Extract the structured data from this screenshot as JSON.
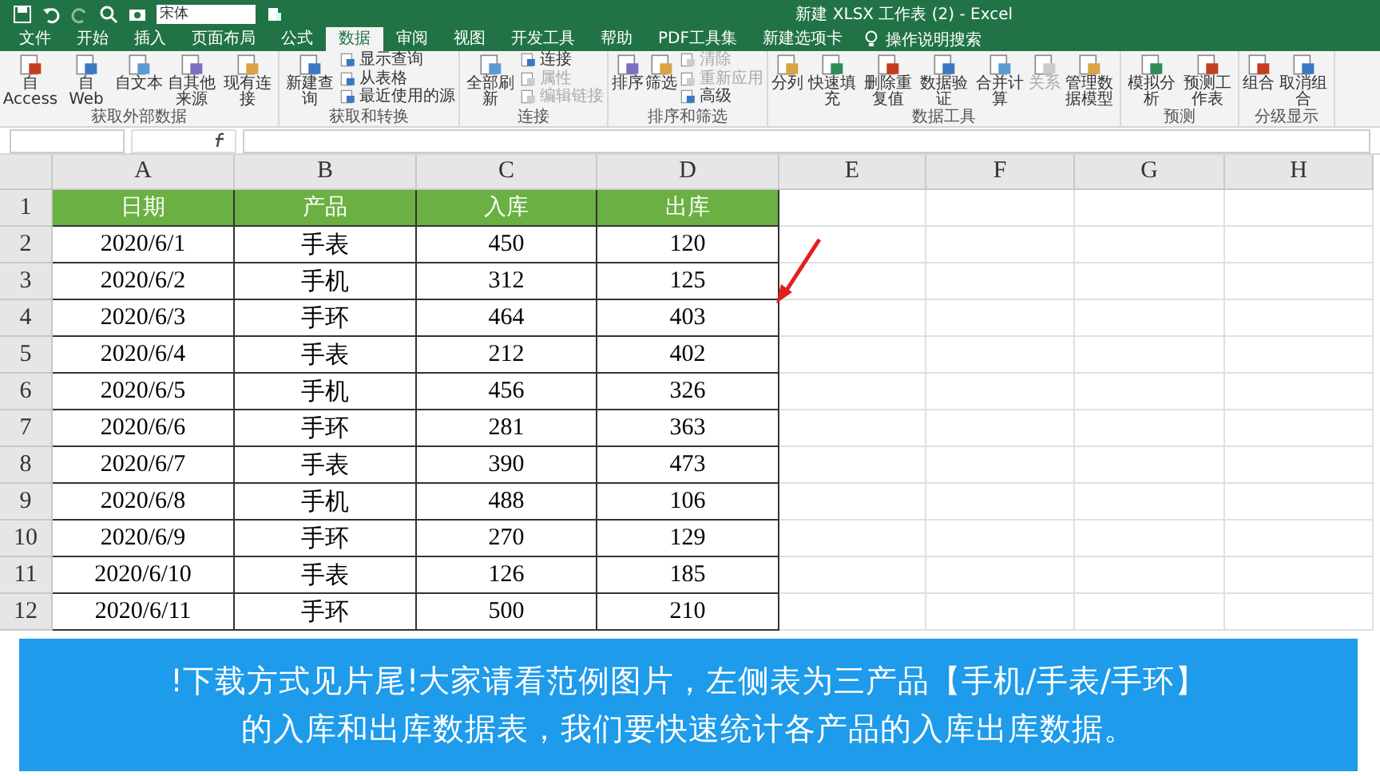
{
  "title_bar": {
    "font_box": "宋体",
    "title": "新建 XLSX 工作表 (2) - Excel"
  },
  "tabs": [
    {
      "label": "文件",
      "selected": false
    },
    {
      "label": "开始",
      "selected": false
    },
    {
      "label": "插入",
      "selected": false
    },
    {
      "label": "页面布局",
      "selected": false
    },
    {
      "label": "公式",
      "selected": false
    },
    {
      "label": "数据",
      "selected": true
    },
    {
      "label": "审阅",
      "selected": false
    },
    {
      "label": "视图",
      "selected": false
    },
    {
      "label": "开发工具",
      "selected": false
    },
    {
      "label": "帮助",
      "selected": false
    },
    {
      "label": "PDF工具集",
      "selected": false
    },
    {
      "label": "新建选项卡",
      "selected": false
    }
  ],
  "tell_me": "操作说明搜索",
  "ribbon_groups": [
    {
      "label": "获取外部数据",
      "buttons": [
        {
          "label": "自 Access",
          "kind": "large",
          "disabled": false
        },
        {
          "label": "自 Web",
          "kind": "large",
          "disabled": false
        },
        {
          "label": "自文本",
          "kind": "large",
          "disabled": false
        },
        {
          "label": "自其他来源",
          "kind": "large",
          "disabled": false
        },
        {
          "label": "现有连接",
          "kind": "large",
          "disabled": false
        }
      ]
    },
    {
      "label": "获取和转换",
      "buttons": [
        {
          "label": "新建查询",
          "kind": "large",
          "disabled": false
        },
        {
          "label": "显示查询",
          "kind": "small",
          "disabled": false
        },
        {
          "label": "从表格",
          "kind": "small",
          "disabled": false
        },
        {
          "label": "最近使用的源",
          "kind": "small",
          "disabled": false
        }
      ]
    },
    {
      "label": "连接",
      "buttons": [
        {
          "label": "全部刷新",
          "kind": "large",
          "disabled": false
        },
        {
          "label": "连接",
          "kind": "small",
          "disabled": false
        },
        {
          "label": "属性",
          "kind": "small",
          "disabled": true
        },
        {
          "label": "编辑链接",
          "kind": "small",
          "disabled": true
        }
      ]
    },
    {
      "label": "排序和筛选",
      "buttons": [
        {
          "label": "排序",
          "kind": "large",
          "disabled": false
        },
        {
          "label": "筛选",
          "kind": "large",
          "disabled": false
        },
        {
          "label": "清除",
          "kind": "small",
          "disabled": true
        },
        {
          "label": "重新应用",
          "kind": "small",
          "disabled": true
        },
        {
          "label": "高级",
          "kind": "small",
          "disabled": false
        }
      ]
    },
    {
      "label": "数据工具",
      "buttons": [
        {
          "label": "分列",
          "kind": "large",
          "disabled": false
        },
        {
          "label": "快速填充",
          "kind": "large",
          "disabled": false
        },
        {
          "label": "删除重复值",
          "kind": "large",
          "disabled": false
        },
        {
          "label": "数据验证",
          "kind": "large",
          "disabled": false
        },
        {
          "label": "合并计算",
          "kind": "large",
          "disabled": false
        },
        {
          "label": "关系",
          "kind": "large",
          "disabled": true
        },
        {
          "label": "管理数据模型",
          "kind": "large",
          "disabled": false
        }
      ]
    },
    {
      "label": "预测",
      "buttons": [
        {
          "label": "模拟分析",
          "kind": "large",
          "disabled": false
        },
        {
          "label": "预测工作表",
          "kind": "large",
          "disabled": false
        }
      ]
    },
    {
      "label": "分级显示",
      "buttons": [
        {
          "label": "组合",
          "kind": "large",
          "disabled": false
        },
        {
          "label": "取消组合",
          "kind": "large",
          "disabled": false
        }
      ]
    }
  ],
  "sheet": {
    "columns": [
      "A",
      "B",
      "C",
      "D",
      "E",
      "F",
      "G",
      "H"
    ],
    "rows": [
      {
        "number": "1",
        "kind": "header",
        "cells": [
          "日期",
          "产品",
          "入库",
          "出库"
        ]
      },
      {
        "number": "2",
        "kind": "data",
        "cells": [
          "2020/6/1",
          "手表",
          "450",
          "120"
        ]
      },
      {
        "number": "3",
        "kind": "data",
        "cells": [
          "2020/6/2",
          "手机",
          "312",
          "125"
        ]
      },
      {
        "number": "4",
        "kind": "data",
        "cells": [
          "2020/6/3",
          "手环",
          "464",
          "403"
        ]
      },
      {
        "number": "5",
        "kind": "data",
        "cells": [
          "2020/6/4",
          "手表",
          "212",
          "402"
        ]
      },
      {
        "number": "6",
        "kind": "data",
        "cells": [
          "2020/6/5",
          "手机",
          "456",
          "326"
        ]
      },
      {
        "number": "7",
        "kind": "data",
        "cells": [
          "2020/6/6",
          "手环",
          "281",
          "363"
        ]
      },
      {
        "number": "8",
        "kind": "data",
        "cells": [
          "2020/6/7",
          "手表",
          "390",
          "473"
        ]
      },
      {
        "number": "9",
        "kind": "data",
        "cells": [
          "2020/6/8",
          "手机",
          "488",
          "106"
        ]
      },
      {
        "number": "10",
        "kind": "data",
        "cells": [
          "2020/6/9",
          "手环",
          "270",
          "129"
        ]
      },
      {
        "number": "11",
        "kind": "data",
        "cells": [
          "2020/6/10",
          "手表",
          "126",
          "185"
        ]
      },
      {
        "number": "12",
        "kind": "data",
        "cells": [
          "2020/6/11",
          "手环",
          "500",
          "210"
        ]
      }
    ]
  },
  "subtitle": {
    "lines": [
      "!下载方式见片尾!大家请看范例图片，左侧表为三产品【手机/手表/手环】",
      "的入库和出库数据表，我们要快速统计各产品的入库出库数据。"
    ]
  }
}
